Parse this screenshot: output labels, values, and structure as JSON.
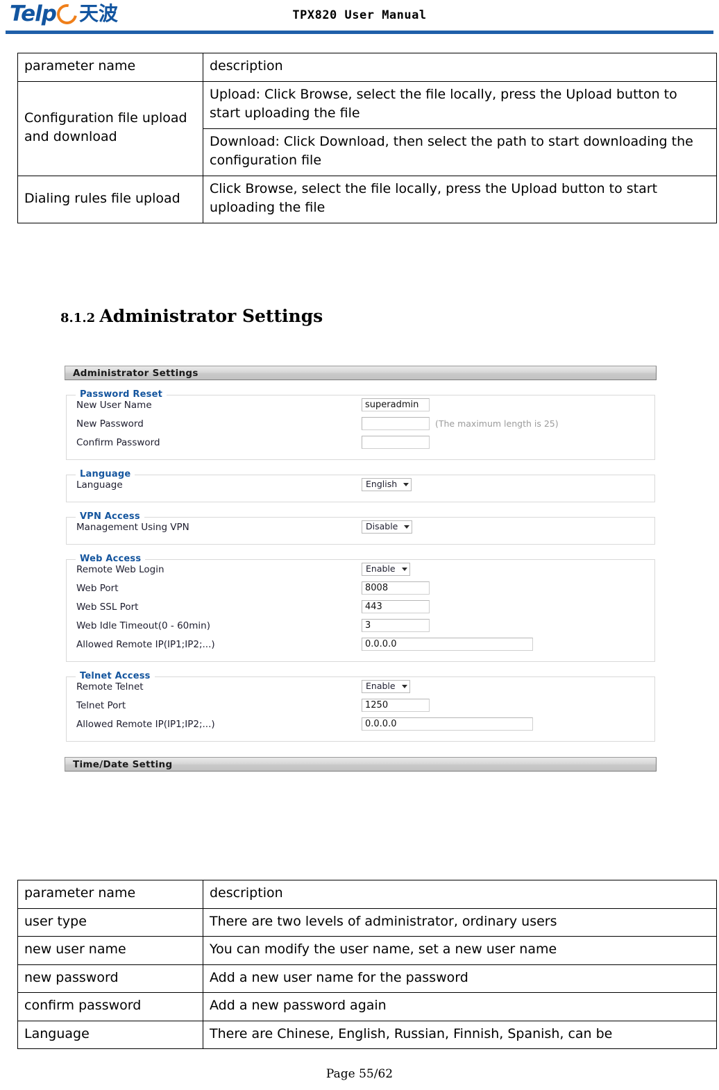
{
  "doc_header": {
    "logo_word": "Telp",
    "logo_cn": "天波",
    "title": "TPX820 User Manual"
  },
  "section": {
    "number": "8.1.2 ",
    "title": "Administrator Settings"
  },
  "table_top": {
    "headers": [
      "parameter name",
      "description"
    ],
    "rows": [
      {
        "param": "Configuration file upload and download",
        "descriptions": [
          "Upload: Click Browse, select the file locally, press the Upload button to start uploading the file",
          "Download: Click Download, then select the path to start downloading the configuration file"
        ]
      },
      {
        "param": "Dialing rules file upload",
        "descriptions": [
          "Click Browse, select the file locally, press the Upload button to start uploading the file"
        ]
      }
    ]
  },
  "table_bottom": {
    "headers": [
      "parameter name",
      "description"
    ],
    "rows": [
      {
        "param": "user type",
        "description": "There are two levels of administrator, ordinary users"
      },
      {
        "param": "new user name",
        "description": "You can modify the user name, set a new user name"
      },
      {
        "param": "new password",
        "description": "Add a new user name for the password"
      },
      {
        "param": "confirm password",
        "description": "Add a new password again"
      },
      {
        "param": "Language",
        "description": "There are Chinese, English, Russian, Finnish, Spanish, can be"
      }
    ]
  },
  "screenshot": {
    "title_bar": "Administrator Settings",
    "password_reset": {
      "legend": "Password Reset",
      "new_user_name_label": "New User Name",
      "new_user_name_value": "superadmin",
      "new_password_label": "New Password",
      "new_password_value": "",
      "new_password_hint": "(The maximum length is 25)",
      "confirm_password_label": "Confirm Password",
      "confirm_password_value": ""
    },
    "language": {
      "legend": "Language",
      "language_label": "Language",
      "language_value": "English"
    },
    "vpn_access": {
      "legend": "VPN Access",
      "management_label": "Management Using VPN",
      "management_value": "Disable"
    },
    "web_access": {
      "legend": "Web Access",
      "remote_web_login_label": "Remote Web Login",
      "remote_web_login_value": "Enable",
      "web_port_label": "Web Port",
      "web_port_value": "8008",
      "web_ssl_port_label": "Web SSL Port",
      "web_ssl_port_value": "443",
      "web_idle_timeout_label": "Web Idle Timeout(0 - 60min)",
      "web_idle_timeout_value": "3",
      "allowed_remote_ip_label": "Allowed Remote IP(IP1;IP2;...)",
      "allowed_remote_ip_value": "0.0.0.0"
    },
    "telnet_access": {
      "legend": "Telnet Access",
      "remote_telnet_label": "Remote Telnet",
      "remote_telnet_value": "Enable",
      "telnet_port_label": "Telnet Port",
      "telnet_port_value": "1250",
      "allowed_remote_ip_label": "Allowed Remote IP(IP1;IP2;...)",
      "allowed_remote_ip_value": "0.0.0.0"
    },
    "time_date_bar": "Time/Date Setting"
  },
  "footer": {
    "page": "Page 55/62"
  },
  "colors": {
    "brand_blue": "#1255a0",
    "brand_orange": "#ef7f1a",
    "rule_blue": "#1f5fa9",
    "legend_blue": "#14559e"
  }
}
